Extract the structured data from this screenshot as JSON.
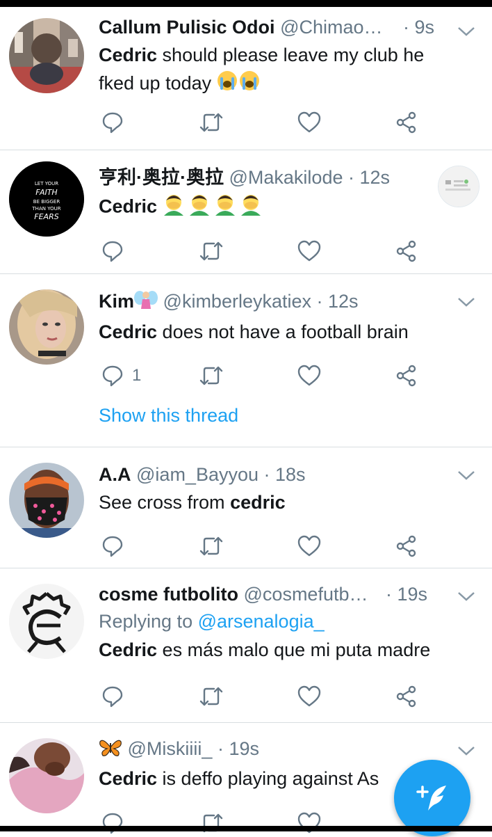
{
  "tweets": [
    {
      "name": "Callum Pulisic Odoi",
      "handle": "@Chimao…",
      "time": "· 9s",
      "text_bold": "Cedric",
      "text_rest": " should please leave my club he fked up today",
      "text_line2": "fked up today"
    },
    {
      "name": "亨利·奥拉·奥拉",
      "handle": "@Makakilode",
      "time": "· 12s",
      "text_bold": "Cedric",
      "avatar_text": [
        "LET YOUR",
        "FAITH",
        "BE BIGGER",
        "THAN YOUR",
        "FEARS"
      ]
    },
    {
      "name": "Kim",
      "handle": "@kimberleykatiex",
      "time": "· 12s",
      "text_bold": "Cedric",
      "text_rest": " does not have a football brain",
      "reply_count": "1",
      "thread_label": "Show this thread"
    },
    {
      "name": "A.A",
      "handle": "@iam_Bayyou",
      "time": "· 18s",
      "text_pre": "See cross from ",
      "text_bold": "cedric"
    },
    {
      "name": "cosme futbolito",
      "handle": "@cosmefutb…",
      "time": "· 19s",
      "reply_label": "Replying to ",
      "reply_mention": "@arsenalogia_",
      "text_bold": "Cedric",
      "text_rest": " es más malo que mi puta madre"
    },
    {
      "name": "",
      "handle": "@Miskiiii_",
      "time": "· 19s",
      "text_bold": "Cedric",
      "text_rest": " is deffo playing against As"
    }
  ],
  "colors": {
    "accent": "#1da1f2",
    "text": "#14171a",
    "secondary": "#657786",
    "divider": "#d8dde1"
  },
  "icons": {
    "reply": "reply-icon",
    "retweet": "retweet-icon",
    "like": "heart-icon",
    "share": "share-icon",
    "chevron": "chevron-down-icon",
    "compose": "compose-tweet-icon"
  }
}
